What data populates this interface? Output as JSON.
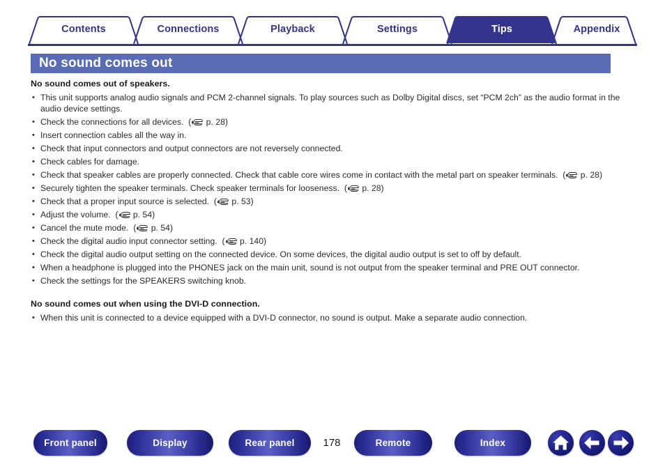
{
  "tabs": [
    {
      "label": "Contents",
      "active": false
    },
    {
      "label": "Connections",
      "active": false
    },
    {
      "label": "Playback",
      "active": false
    },
    {
      "label": "Settings",
      "active": false
    },
    {
      "label": "Tips",
      "active": true
    },
    {
      "label": "Appendix",
      "active": false
    }
  ],
  "section": {
    "title": "No sound comes out"
  },
  "sections": [
    {
      "heading": "No sound comes out of speakers.",
      "items": [
        {
          "text": "This unit supports analog audio signals and PCM 2-channel signals. To play sources such as Dolby Digital discs, set “PCM 2ch” as the audio format in the audio device settings.",
          "ref": ""
        },
        {
          "text": "Check the connections for all devices.",
          "ref": "p. 28"
        },
        {
          "text": "Insert connection cables all the way in.",
          "ref": ""
        },
        {
          "text": "Check that input connectors and output connectors are not reversely connected.",
          "ref": ""
        },
        {
          "text": "Check cables for damage.",
          "ref": ""
        },
        {
          "text": "Check that speaker cables are properly connected. Check that cable core wires come in contact with the metal part on speaker terminals.",
          "ref": "p. 28"
        },
        {
          "text": "Securely tighten the speaker terminals. Check speaker terminals for looseness.",
          "ref": "p. 28"
        },
        {
          "text": "Check that a proper input source is selected.",
          "ref": "p. 53"
        },
        {
          "text": "Adjust the volume.",
          "ref": "p. 54"
        },
        {
          "text": "Cancel the mute mode.",
          "ref": "p. 54"
        },
        {
          "text": "Check the digital audio input connector setting.",
          "ref": "p. 140"
        },
        {
          "text": "Check the digital audio output setting on the connected device. On some devices, the digital audio output is set to off by default.",
          "ref": ""
        },
        {
          "text": "When a headphone is plugged into the PHONES jack on the main unit, sound is not output from the speaker terminal and PRE OUT connector.",
          "ref": ""
        },
        {
          "text": "Check the settings for the SPEAKERS switching knob.",
          "ref": ""
        }
      ]
    },
    {
      "heading": "No sound comes out when using the DVI-D connection.",
      "items": [
        {
          "text": "When this unit is connected to a device equipped with a DVI-D connector, no sound is output. Make a separate audio connection.",
          "ref": ""
        }
      ]
    }
  ],
  "footer": {
    "buttons": [
      {
        "label": "Front panel",
        "name": "front-panel-button"
      },
      {
        "label": "Display",
        "name": "display-button"
      },
      {
        "label": "Rear panel",
        "name": "rear-panel-button"
      },
      {
        "label": "Remote",
        "name": "remote-button"
      },
      {
        "label": "Index",
        "name": "index-button"
      }
    ],
    "page_number": "178",
    "icons": [
      {
        "name": "home-icon",
        "glyph": "home"
      },
      {
        "name": "back-arrow-icon",
        "glyph": "arrow-left"
      },
      {
        "name": "forward-arrow-icon",
        "glyph": "arrow-right"
      }
    ]
  },
  "colors": {
    "tab_blue": "#33348e",
    "tab_active_fill": "#33348e",
    "title_bar": "#5a6cb4",
    "button_blue": "#23268f",
    "text": "#2a2a2a"
  }
}
